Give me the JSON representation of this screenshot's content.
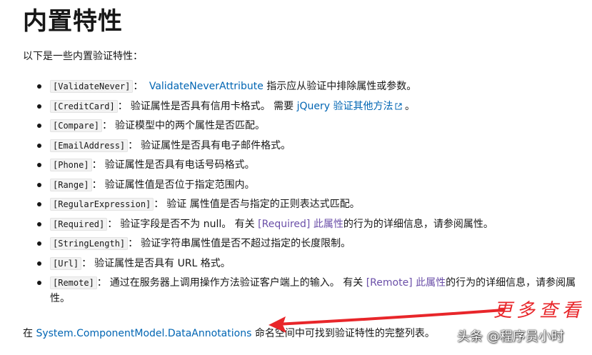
{
  "title": "内置特性",
  "intro": "以下是一些内置验证特性：",
  "items": [
    {
      "tag": "[ValidateNever]",
      "colon": "：",
      "pre": "",
      "link": "ValidateNeverAttribute",
      "post": " 指示应从验证中排除属性或参数。"
    },
    {
      "tag": "[CreditCard]",
      "colon": "：",
      "pre": "验证属性是否具有信用卡格式。 需要 ",
      "link": "jQuery 验证其他方法",
      "post": " 。"
    },
    {
      "tag": "[Compare]",
      "colon": "：",
      "text": "验证模型中的两个属性是否匹配。"
    },
    {
      "tag": "[EmailAddress]",
      "colon": "：",
      "text": "验证属性是否具有电子邮件格式。"
    },
    {
      "tag": "[Phone]",
      "colon": "：",
      "text": "验证属性是否具有电话号码格式。"
    },
    {
      "tag": "[Range]",
      "colon": "：",
      "text": "验证属性值是否位于指定范围内。"
    },
    {
      "tag": "[RegularExpression]",
      "colon": "：",
      "text": "验证 属性值是否与指定的正则表达式匹配。"
    },
    {
      "tag": "[Required]",
      "colon": "：",
      "pre": "验证字段是否不为 null。 有关 ",
      "link": "[Required] 此属性",
      "post": "的行为的详细信息，请参阅属性。"
    },
    {
      "tag": "[StringLength]",
      "colon": "：",
      "text": "验证字符串属性值是否不超过指定的长度限制。"
    },
    {
      "tag": "[Url]",
      "colon": "：",
      "text": "验证属性是否具有 URL 格式。"
    },
    {
      "tag": "[Remote]",
      "colon": "：",
      "pre": "通过在服务器上调用操作方法验证客户端上的输入。 有关 ",
      "link": "[Remote] 此属性",
      "post": "的行为的详细信息，请参阅属性。"
    }
  ],
  "outro": {
    "pre": "在 ",
    "link": "System.ComponentModel.DataAnnotations",
    "post": " 命名空间中可找到验证特性的完整列表。"
  },
  "annotation": {
    "label": "更多查看",
    "color": "#e8262a"
  },
  "watermark": "头条 @程序员小时",
  "colors": {
    "text": "#171717",
    "link": "#0065b3",
    "visited_link": "#6b4fa8",
    "code_bg": "#f2f2f2"
  },
  "icons": {
    "external": "external-link-icon",
    "bullet": "bullet-dot-icon",
    "arrow": "red-arrow-icon"
  }
}
